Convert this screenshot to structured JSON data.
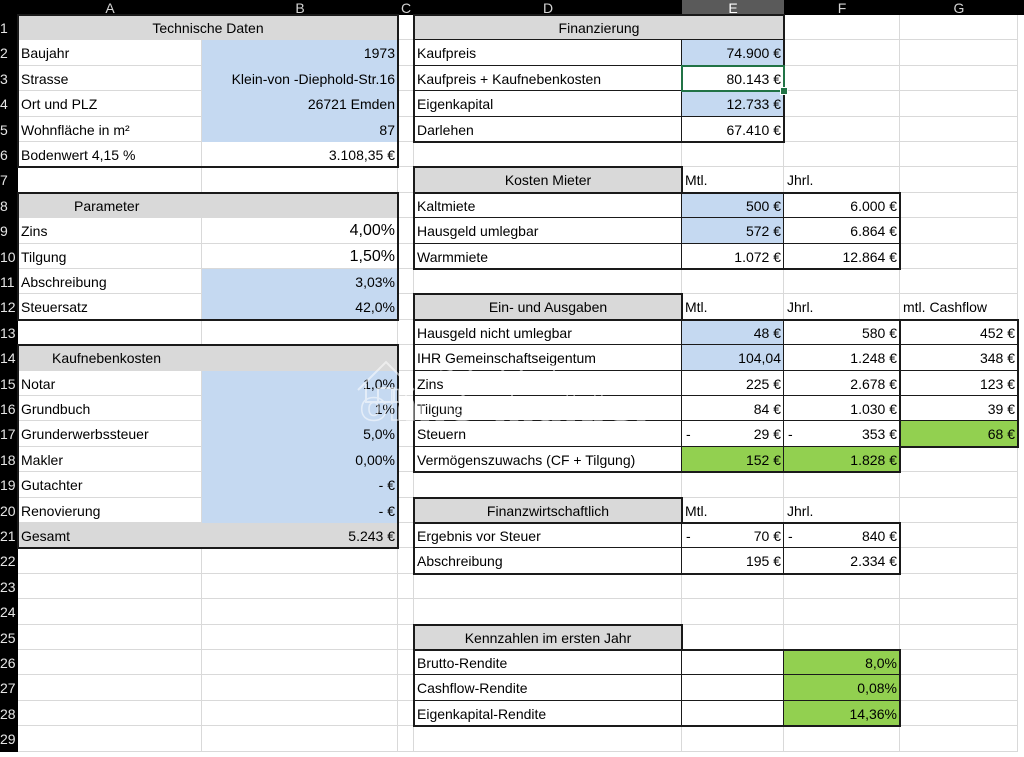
{
  "columns": [
    "A",
    "B",
    "C",
    "D",
    "E",
    "F",
    "G"
  ],
  "active_column": "E",
  "rows": [
    "1",
    "2",
    "3",
    "4",
    "5",
    "6",
    "7",
    "8",
    "9",
    "10",
    "11",
    "12",
    "13",
    "14",
    "15",
    "16",
    "17",
    "18",
    "19",
    "20",
    "21",
    "22",
    "23",
    "24",
    "25",
    "26",
    "27",
    "28",
    "29"
  ],
  "technische_daten": {
    "header": "Technische Daten",
    "rows": [
      {
        "label": "Baujahr",
        "value": "1973"
      },
      {
        "label": "Strasse",
        "value": "Klein-von -Diephold-Str.16"
      },
      {
        "label": "Ort und PLZ",
        "value": "26721 Emden"
      },
      {
        "label": "Wohnfläche in m²",
        "value": "87"
      },
      {
        "label": "Bodenwert 4,15 %",
        "value": "3.108,35 €"
      }
    ]
  },
  "parameter": {
    "header": "Parameter",
    "rows": [
      {
        "label": "Zins",
        "value": "4,00%"
      },
      {
        "label": "Tilgung",
        "value": "1,50%"
      },
      {
        "label": "Abschreibung",
        "value": "3,03%"
      },
      {
        "label": "Steuersatz",
        "value": "42,0%"
      }
    ]
  },
  "kaufnebenkosten": {
    "header": "Kaufnebenkosten",
    "rows": [
      {
        "label": "Notar",
        "value": "1,0%"
      },
      {
        "label": "Grundbuch",
        "value": "1%"
      },
      {
        "label": "Grunderwerbssteuer",
        "value": "5,0%"
      },
      {
        "label": "Makler",
        "value": "0,00%"
      },
      {
        "label": "Gutachter",
        "value": "-    €"
      },
      {
        "label": "Renovierung",
        "value": "-    €"
      }
    ],
    "total_label": "Gesamt",
    "total_value": "5.243 €"
  },
  "finanzierung": {
    "header": "Finanzierung",
    "rows": [
      {
        "label": "Kaufpreis",
        "value": "74.900 €"
      },
      {
        "label": "Kaufpreis + Kaufnebenkosten",
        "value": "80.143 €"
      },
      {
        "label": "Eigenkapital",
        "value": "12.733 €"
      },
      {
        "label": "Darlehen",
        "value": "67.410 €"
      }
    ]
  },
  "kosten_mieter": {
    "header": "Kosten Mieter",
    "col_mtl": "Mtl.",
    "col_jhrl": "Jhrl.",
    "rows": [
      {
        "label": "Kaltmiete",
        "mtl": "500 €",
        "jhrl": "6.000 €"
      },
      {
        "label": "Hausgeld umlegbar",
        "mtl": "572 €",
        "jhrl": "6.864 €"
      },
      {
        "label": "Warmmiete",
        "mtl": "1.072 €",
        "jhrl": "12.864 €"
      }
    ]
  },
  "ein_ausgaben": {
    "header": "Ein- und Ausgaben",
    "col_mtl": "Mtl.",
    "col_jhrl": "Jhrl.",
    "col_cashflow": "mtl. Cashflow",
    "rows": [
      {
        "label": "Hausgeld nicht umlegbar",
        "mtl": "48 €",
        "jhrl": "580 €",
        "cf": "452 €"
      },
      {
        "label": "IHR Gemeinschaftseigentum",
        "mtl": "104,04",
        "jhrl": "1.248 €",
        "cf": "348 €"
      },
      {
        "label": "Zins",
        "mtl": "225 €",
        "jhrl": "2.678 €",
        "cf": "123 €"
      },
      {
        "label": "Tilgung",
        "mtl": "84 €",
        "jhrl": "1.030 €",
        "cf": "39 €"
      },
      {
        "label": "Steuern",
        "neg_mtl": "-",
        "mtl": "29 €",
        "neg_jhrl": "-",
        "jhrl": "353 €",
        "cf": "68 €"
      }
    ],
    "vz_label": "Vermögenszuwachs (CF + Tilgung)",
    "vz_mtl": "152 €",
    "vz_jhrl": "1.828 €"
  },
  "finanzwirtschaftlich": {
    "header": "Finanzwirtschaftlich",
    "col_mtl": "Mtl.",
    "col_jhrl": "Jhrl.",
    "rows": [
      {
        "label": "Ergebnis vor Steuer",
        "neg_mtl": "-",
        "mtl": "70 €",
        "neg_jhrl": "-",
        "jhrl": "840 €"
      },
      {
        "label": "Abschreibung",
        "mtl": "195 €",
        "jhrl": "2.334 €"
      }
    ]
  },
  "kennzahlen": {
    "header": "Kennzahlen im ersten Jahr",
    "rows": [
      {
        "label": "Brutto-Rendite",
        "value": "8,0%"
      },
      {
        "label": "Cashflow-Rendite",
        "value": "0,08%"
      },
      {
        "label": "Eigenkapital-Rendite",
        "value": "14,36%"
      }
    ]
  },
  "watermark": "ohne-makler",
  "colors": {
    "input_blue": "#c5d9f1",
    "header_gray": "#d9d9d9",
    "result_green": "#92d050",
    "selection_green": "#217346"
  }
}
